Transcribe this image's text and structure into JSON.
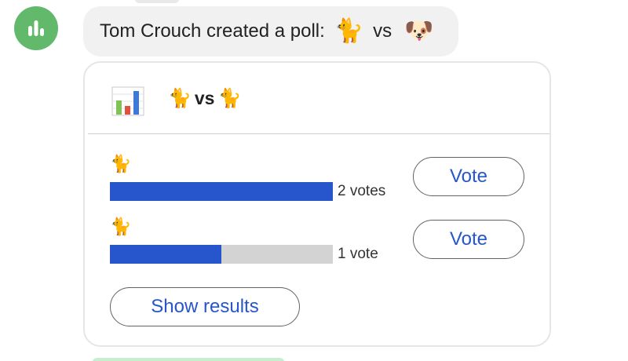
{
  "avatar": {
    "icon": "poll-bars-icon",
    "color": "#62b96c"
  },
  "message": {
    "text": "Tom Crouch created a poll:",
    "emoji_a": "🐈",
    "vs": "vs",
    "emoji_b": "🐶"
  },
  "poll": {
    "icon": "bar-chart-icon",
    "title_emoji_a": "🐈",
    "title_vs": "vs",
    "title_emoji_b": "🐈",
    "options": [
      {
        "emoji": "🐈",
        "votes_label": "2 votes",
        "vote_fraction": 1.0,
        "vote_label": "Vote"
      },
      {
        "emoji": "🐈",
        "votes_label": "1 vote",
        "vote_fraction": 0.5,
        "vote_label": "Vote"
      }
    ],
    "show_results_label": "Show results"
  },
  "colors": {
    "accent": "#2655cc",
    "bar_track": "#d3d3d3",
    "bubble_bg": "#f1f1f1"
  }
}
